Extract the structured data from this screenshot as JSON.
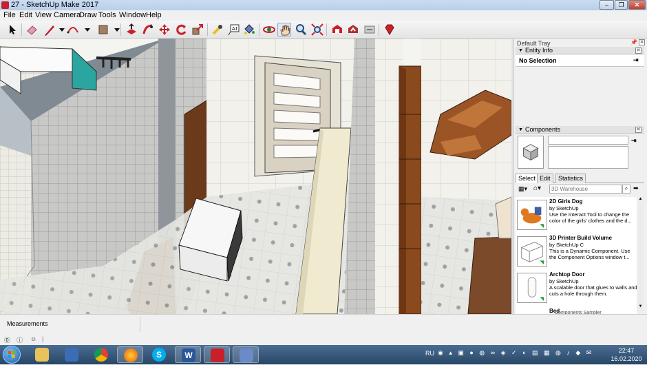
{
  "window": {
    "title": "27 - SketchUp Make 2017",
    "controls": [
      "–",
      "❐",
      "✕"
    ]
  },
  "menu": [
    "File",
    "Edit",
    "View",
    "Camera",
    "Draw",
    "Tools",
    "Window",
    "Help"
  ],
  "toolbar": {
    "tools": [
      {
        "name": "select-tool",
        "icon": "cursor-icon"
      },
      {
        "name": "eraser-tool",
        "icon": "eraser-icon"
      },
      {
        "name": "line-tool",
        "icon": "pencil-icon"
      },
      {
        "name": "arc-tool",
        "icon": "arc-icon"
      },
      {
        "name": "rectangle-tool",
        "icon": "rectangle-icon"
      },
      {
        "name": "push-pull-tool",
        "icon": "push-pull-icon"
      },
      {
        "name": "follow-me-tool",
        "icon": "follow-me-icon"
      },
      {
        "name": "move-tool",
        "icon": "move-icon"
      },
      {
        "name": "rotate-tool",
        "icon": "rotate-icon"
      },
      {
        "name": "scale-tool",
        "icon": "scale-icon"
      },
      {
        "name": "tape-measure-tool",
        "icon": "tape-measure-icon"
      },
      {
        "name": "text-tool",
        "icon": "text-icon"
      },
      {
        "name": "paint-bucket-tool",
        "icon": "paint-bucket-icon"
      },
      {
        "name": "orbit-tool",
        "icon": "orbit-icon"
      },
      {
        "name": "pan-tool",
        "icon": "hand-icon"
      },
      {
        "name": "zoom-tool",
        "icon": "magnifier-icon"
      },
      {
        "name": "zoom-extents-tool",
        "icon": "zoom-extents-icon"
      },
      {
        "name": "warehouse-tool",
        "icon": "warehouse-icon"
      },
      {
        "name": "share-model-tool",
        "icon": "share-model-icon"
      },
      {
        "name": "extension-warehouse-tool",
        "icon": "extension-icon"
      },
      {
        "name": "ruby-tool",
        "icon": "ruby-icon"
      }
    ]
  },
  "tray": {
    "title": "Default Tray",
    "entity_info": {
      "header": "Entity Info",
      "selection": "No Selection"
    },
    "components": {
      "header": "Components",
      "tabs": [
        "Select",
        "Edit",
        "Statistics"
      ],
      "active_tab": "Select",
      "search_placeholder": "3D Warehouse",
      "items": [
        {
          "name": "2D Girls Dog",
          "by": "by SketchUp",
          "desc": "Use the Interact Tool to change the color of the girls' clothes and the d..."
        },
        {
          "name": "3D Printer Build Volume",
          "by": "by SketchUp C",
          "desc": "This is a Dynamic Component. Use the Component Options window t..."
        },
        {
          "name": "Archtop Door",
          "by": "by SketchUp",
          "desc": "A scalable door that glues to walls and cuts a hole through them."
        },
        {
          "name": "Bed",
          "by": "",
          "desc": ""
        }
      ],
      "footer": "Components Sampler"
    }
  },
  "status": {
    "measurements_label": "Measurements",
    "icons": [
      "geo-location-icon",
      "credit-icon",
      "user-icon"
    ]
  },
  "taskbar": {
    "apps": [
      {
        "name": "start-button",
        "label": ""
      },
      {
        "name": "explorer",
        "label": ""
      },
      {
        "name": "media",
        "label": ""
      },
      {
        "name": "chrome",
        "label": ""
      },
      {
        "name": "firefox",
        "label": ""
      },
      {
        "name": "skype",
        "label": "S"
      },
      {
        "name": "word",
        "label": "W"
      },
      {
        "name": "sketchup",
        "label": ""
      },
      {
        "name": "paint",
        "label": ""
      }
    ],
    "lang": "RU",
    "time": "22:47",
    "date": "16.02.2020"
  },
  "colors": {
    "accent": "#c8202a",
    "tray_bg": "#f0f0f0",
    "taskbar": "#284767"
  }
}
